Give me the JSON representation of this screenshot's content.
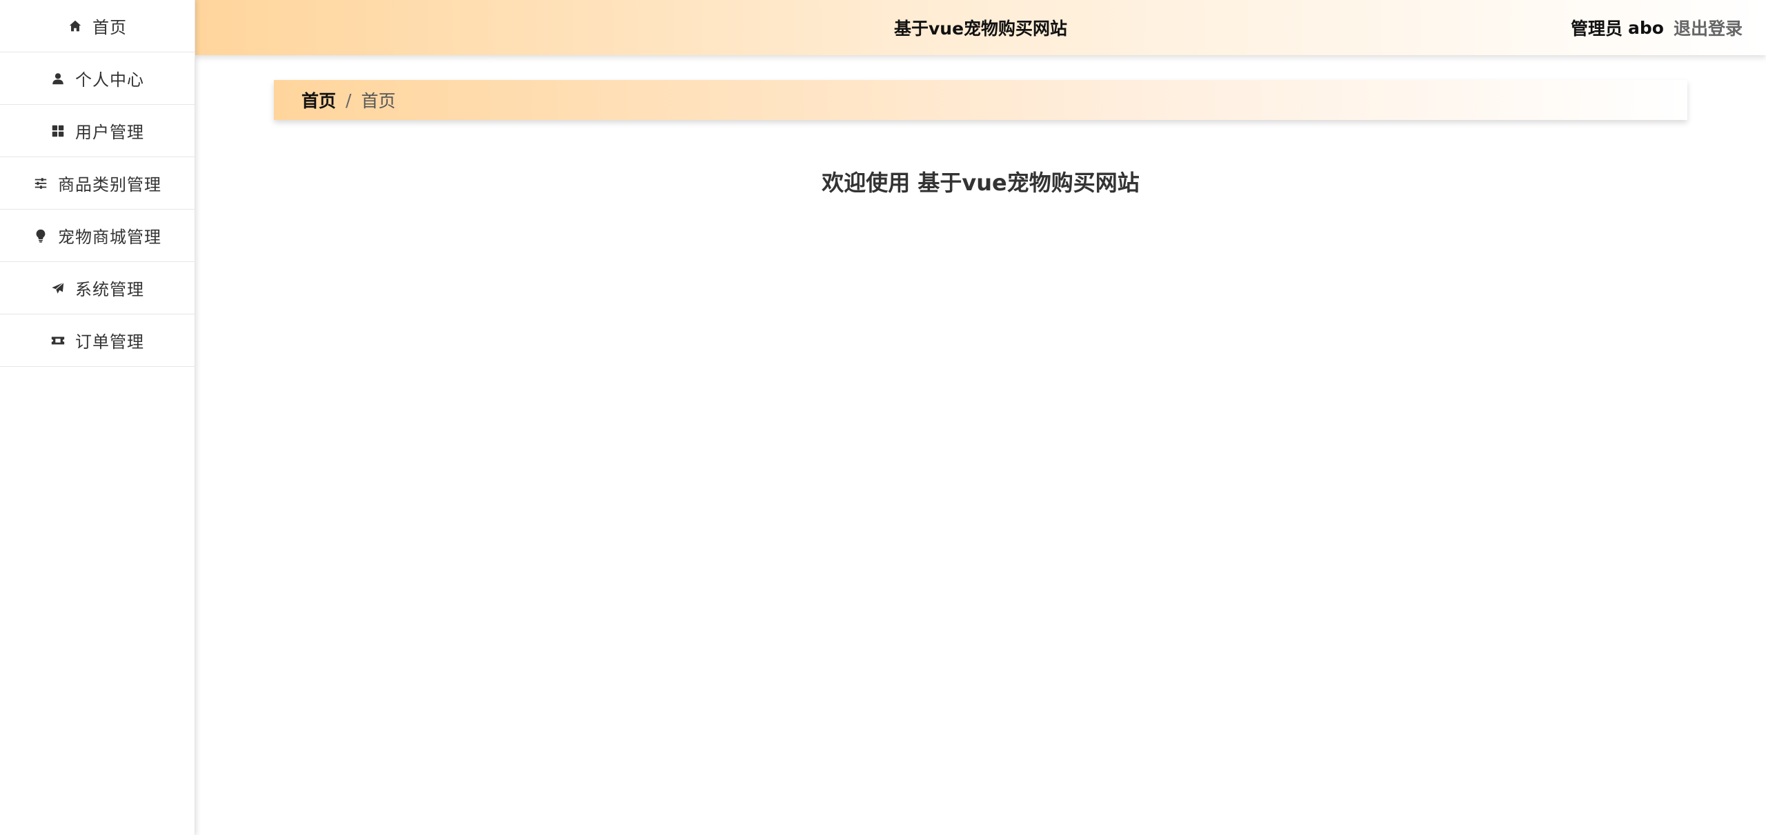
{
  "sidebar": {
    "items": [
      {
        "label": "首页",
        "icon": "home-icon"
      },
      {
        "label": "个人中心",
        "icon": "user-icon"
      },
      {
        "label": "用户管理",
        "icon": "grid-icon"
      },
      {
        "label": "商品类别管理",
        "icon": "sliders-icon"
      },
      {
        "label": "宠物商城管理",
        "icon": "lightbulb-icon"
      },
      {
        "label": "系统管理",
        "icon": "paper-plane-icon"
      },
      {
        "label": "订单管理",
        "icon": "ticket-icon"
      }
    ]
  },
  "header": {
    "title": "基于vue宠物购买网站",
    "role": "管理员",
    "username": "abo",
    "logout": "退出登录"
  },
  "breadcrumb": {
    "home": "首页",
    "separator": "/",
    "current": "首页"
  },
  "main": {
    "welcome": "欢迎使用 基于vue宠物购买网站"
  },
  "colors": {
    "accent": "#ffd59c",
    "text": "#333333",
    "muted": "#666666"
  }
}
